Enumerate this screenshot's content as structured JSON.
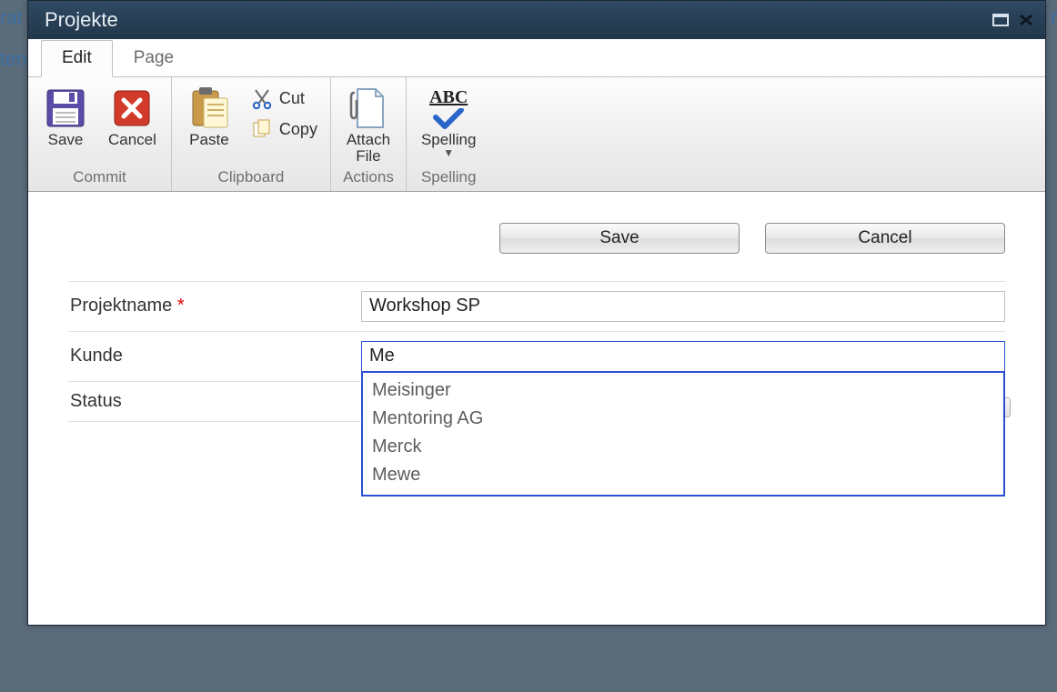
{
  "bg": {
    "left_top": "rat",
    "left_ten": "ten",
    "right_top": "et r"
  },
  "window": {
    "title": "Projekte"
  },
  "tabs": {
    "edit": "Edit",
    "page": "Page"
  },
  "ribbon": {
    "save": "Save",
    "cancel": "Cancel",
    "paste": "Paste",
    "cut": "Cut",
    "copy": "Copy",
    "attach_file": "Attach\nFile",
    "spelling": "Spelling",
    "abc": "ABC",
    "group_commit": "Commit",
    "group_clipboard": "Clipboard",
    "group_actions": "Actions",
    "group_spelling": "Spelling"
  },
  "buttons": {
    "save": "Save",
    "cancel": "Cancel"
  },
  "fields": {
    "projektname": {
      "label": "Projektname",
      "required_mark": "*",
      "value": "Workshop SP"
    },
    "kunde": {
      "label": "Kunde",
      "value": "Me",
      "suggestions": [
        "Meisinger",
        "Mentoring AG",
        "Merck",
        "Mewe"
      ]
    },
    "status": {
      "label": "Status"
    }
  }
}
